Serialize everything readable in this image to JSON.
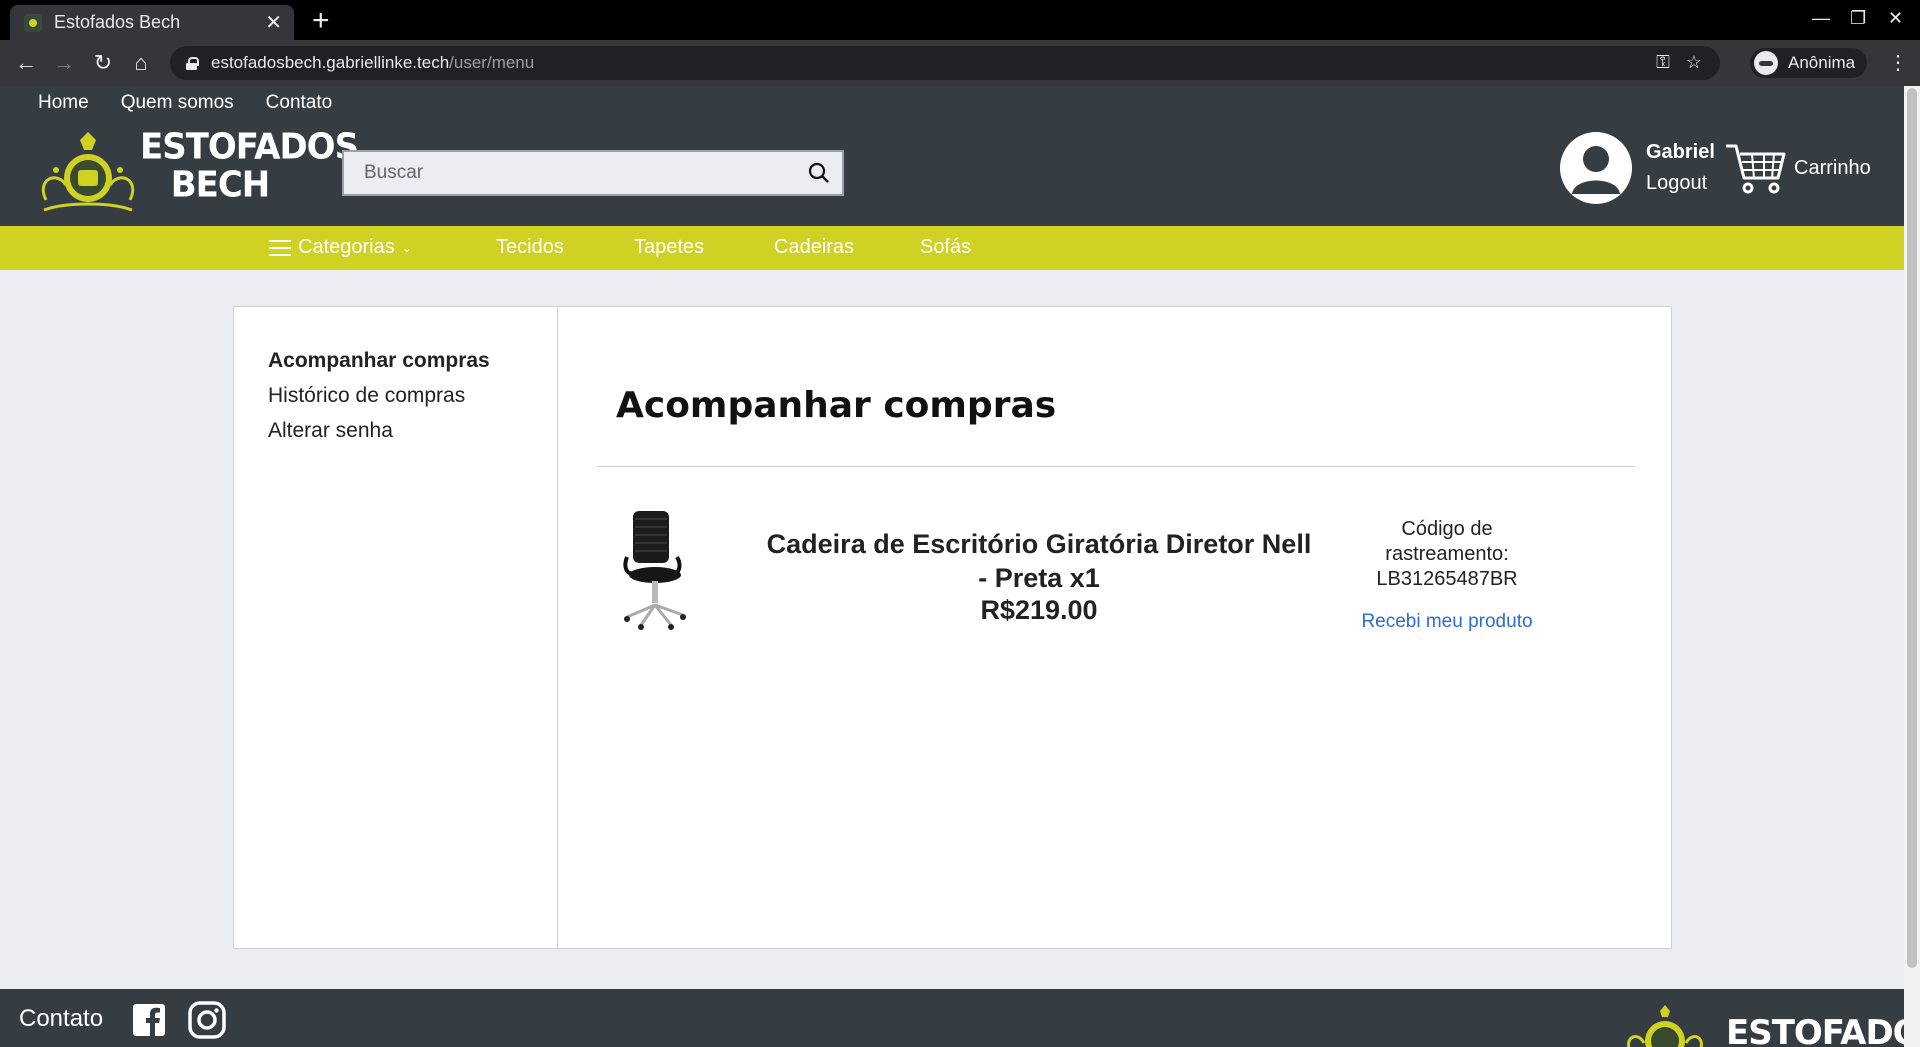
{
  "browser": {
    "tab_title": "Estofados Bech",
    "url_host": "estofadosbech.gabriellinke.tech",
    "url_path": "/user/menu",
    "profile_label": "Anônima"
  },
  "site": {
    "topnav": [
      "Home",
      "Quem somos",
      "Contato"
    ],
    "logo_line1": "ESTOFADOS",
    "logo_line2": "BECH",
    "search_placeholder": "Buscar",
    "user_name": "Gabriel",
    "logout_label": "Logout",
    "cart_label": "Carrinho",
    "categories_label": "Categorias",
    "category_links": [
      "Tecidos",
      "Tapetes",
      "Cadeiras",
      "Sofás"
    ],
    "accent_color": "#cfd123",
    "header_color": "#353d42",
    "link_color": "#2e6bd7"
  },
  "sidebar": {
    "items": [
      "Acompanhar compras",
      "Histórico de compras",
      "Alterar senha"
    ]
  },
  "main": {
    "title": "Acompanhar compras",
    "order": {
      "name": "Cadeira de Escritório Giratória Diretor Nell - Preta x1",
      "price": "R$219.00",
      "tracking_label": "Código de rastreamento:",
      "tracking_code": "LB31265487BR",
      "received_link": "Recebi meu produto"
    }
  },
  "footer": {
    "contact_label": "Contato",
    "logo_text": "ESTOFADOS"
  }
}
